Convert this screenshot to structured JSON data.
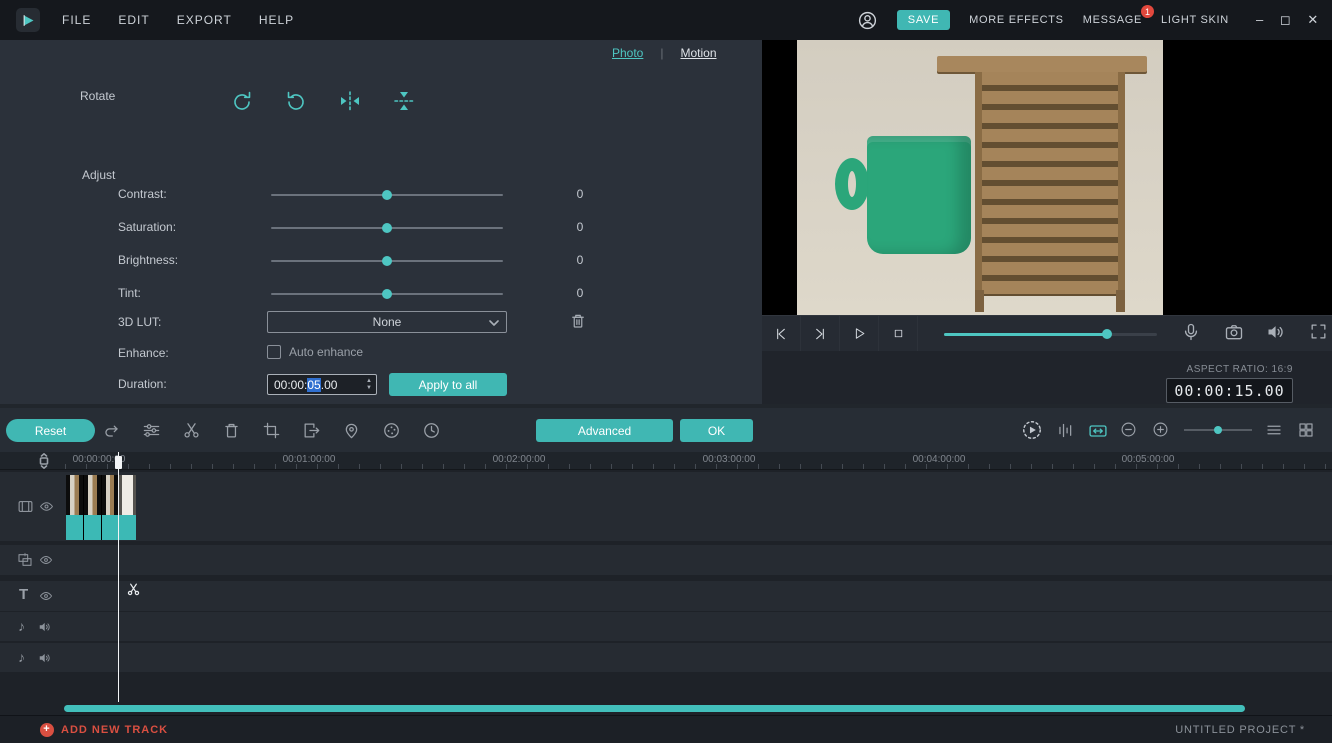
{
  "titlebar": {
    "menus": [
      "FILE",
      "EDIT",
      "EXPORT",
      "HELP"
    ],
    "save": "SAVE",
    "more_effects": "MORE EFFECTS",
    "message": "MESSAGE",
    "message_badge": "1",
    "light_skin": "LIGHT SKIN",
    "minimize": "–",
    "maximize": "◻",
    "close": "✕"
  },
  "edit_panel": {
    "tabs": {
      "photo": "Photo",
      "separator": "|",
      "motion": "Motion"
    },
    "rotate_label": "Rotate",
    "adjust_label": "Adjust",
    "sliders": [
      {
        "label": "Contrast:",
        "value": "0"
      },
      {
        "label": "Saturation:",
        "value": "0"
      },
      {
        "label": "Brightness:",
        "value": "0"
      },
      {
        "label": "Tint:",
        "value": "0"
      }
    ],
    "lut_label": "3D LUT:",
    "lut_value": "None",
    "enhance_label": "Enhance:",
    "enhance_option": "Auto enhance",
    "duration_label": "Duration:",
    "duration": {
      "pre": "00:00:",
      "selected": "05",
      "post": ".00"
    },
    "apply_to_all": "Apply to all",
    "reset": "Reset",
    "advanced": "Advanced",
    "ok": "OK"
  },
  "preview": {
    "aspect_ratio": "ASPECT RATIO: 16:9",
    "timecode": "00:00:15.00"
  },
  "timeline": {
    "ruler": [
      "00:00:00:00",
      "00:01:00:00",
      "00:02:00:00",
      "00:03:00:00",
      "00:04:00:00",
      "00:05:00:00"
    ]
  },
  "statusbar": {
    "add_new_track": "ADD NEW TRACK",
    "project_name": "UNTITLED PROJECT *"
  }
}
